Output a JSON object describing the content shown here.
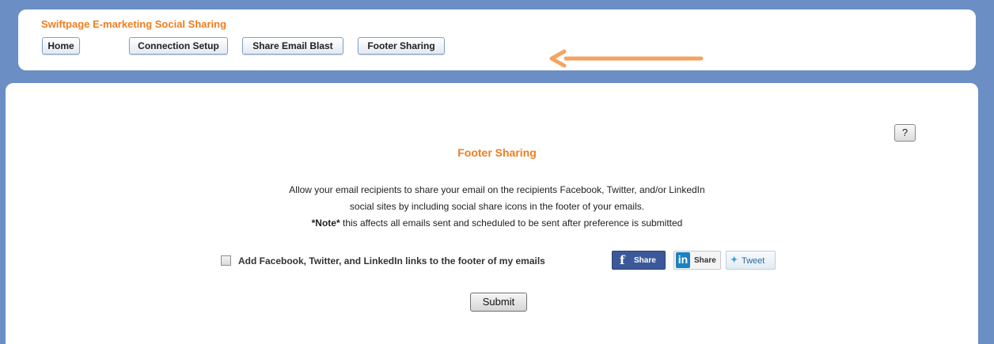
{
  "header": {
    "app_title": "Swiftpage E-marketing Social Sharing",
    "nav": [
      {
        "label": "Home"
      },
      {
        "label": "Connection Setup"
      },
      {
        "label": "Share Email Blast"
      },
      {
        "label": "Footer Sharing"
      }
    ]
  },
  "annotation": {
    "arrow_icon": "left-arrow-icon",
    "arrow_color": "#f4a460"
  },
  "main": {
    "help_label": "?",
    "section_title": "Footer Sharing",
    "description_lines": [
      "Allow your email recipients to share your email on the recipients Facebook, Twitter, and/or LinkedIn",
      "social sites by including social share icons in the footer of your emails."
    ],
    "note_prefix": "*Note*",
    "note_text": " this affects all emails sent and scheduled to be sent after preference is submitted",
    "option_label": "Add Facebook, Twitter, and LinkedIn links to the footer of my emails",
    "option_checked": false,
    "share_buttons": {
      "facebook": {
        "glyph": "f",
        "label": "Share",
        "icon": "facebook-icon"
      },
      "linkedin": {
        "glyph": "in",
        "label": "Share",
        "icon": "linkedin-icon"
      },
      "twitter": {
        "glyph": "✦",
        "label": "Tweet",
        "icon": "twitter-bird-icon"
      }
    },
    "submit_label": "Submit"
  },
  "colors": {
    "background": "#6b8ec4",
    "accent_orange": "#f07d1f",
    "facebook_blue": "#3b5998",
    "linkedin_blue": "#1a83bf"
  }
}
